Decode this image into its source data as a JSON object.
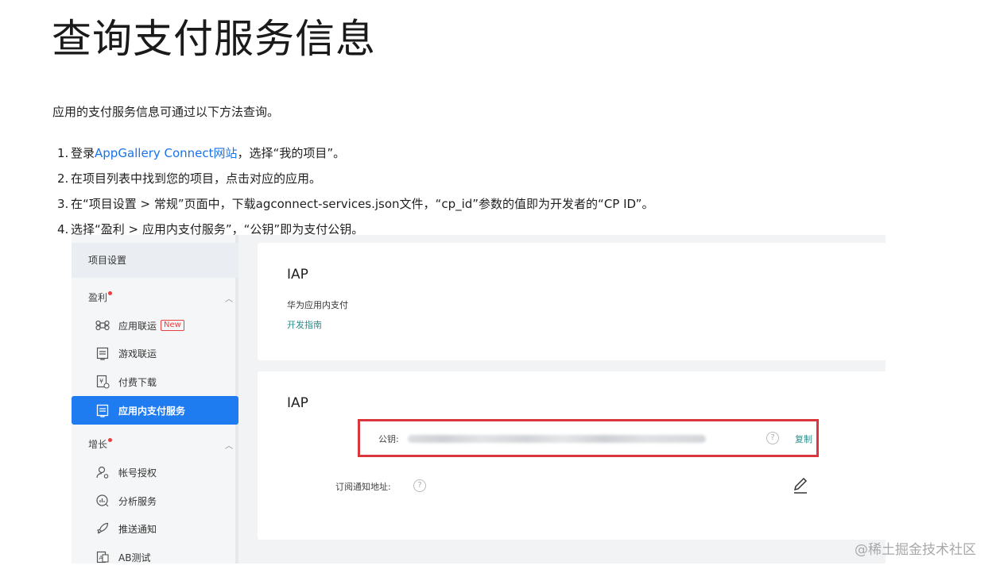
{
  "page": {
    "title": "查询支付服务信息",
    "intro": "应用的支付服务信息可通过以下方法查询。",
    "steps": [
      {
        "num": "1.",
        "before": "登录",
        "link": "AppGallery Connect网站",
        "after": "，选择“我的项目”。"
      },
      {
        "num": "2.",
        "text": "在项目列表中找到您的项目，点击对应的应用。"
      },
      {
        "num": "3.",
        "text": "在“项目设置 > 常规”页面中，下载agconnect-services.json文件，“cp_id”参数的值即为开发者的“CP ID”。"
      },
      {
        "num": "4.",
        "text": "选择“盈利 > 应用内支付服务”，“公钥”即为支付公钥。"
      }
    ],
    "link_color": "#1a73e8"
  },
  "screenshot": {
    "sidebar": {
      "top_item": "项目设置",
      "groups": [
        {
          "label": "盈利",
          "items": [
            {
              "label": "应用联运",
              "icon": "command-icon",
              "badge": "New"
            },
            {
              "label": "游戏联运",
              "icon": "gamepad-icon"
            },
            {
              "label": "付费下载",
              "icon": "paid-download-icon"
            },
            {
              "label": "应用内支付服务",
              "icon": "in-app-payment-icon",
              "active": true
            }
          ]
        },
        {
          "label": "增长",
          "items": [
            {
              "label": "帐号授权",
              "icon": "account-icon"
            },
            {
              "label": "分析服务",
              "icon": "analytics-icon"
            },
            {
              "label": "推送通知",
              "icon": "rocket-icon"
            },
            {
              "label": "AB测试",
              "icon": "ab-test-icon"
            }
          ]
        }
      ],
      "active_color": "#1f7bf0"
    },
    "card1": {
      "title": "IAP",
      "subtitle": "华为应用内支付",
      "link": "开发指南"
    },
    "card2": {
      "title": "IAP",
      "public_key_label": "公钥:",
      "copy_label": "复制",
      "notify_label": "订阅通知地址:",
      "highlight_color": "#d9363e"
    }
  },
  "watermark": "@稀土掘金技术社区"
}
